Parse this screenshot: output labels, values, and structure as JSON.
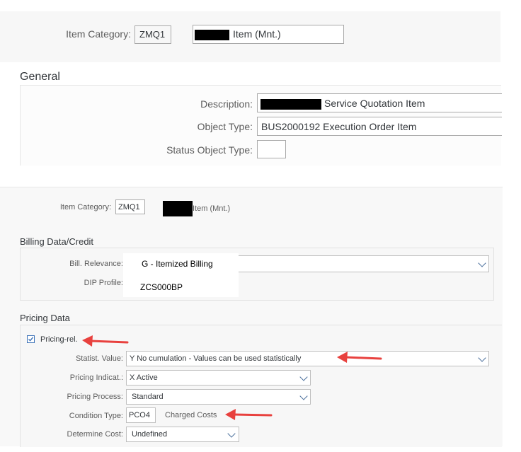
{
  "top": {
    "item_category_label": "Item Category:",
    "item_category_value": "ZMQ1",
    "item_category_desc": "Item (Mnt.)",
    "general_title": "General",
    "description_label": "Description:",
    "description_value": "Service Quotation Item",
    "object_type_label": "Object Type:",
    "object_type_value": "BUS2000192 Execution Order Item",
    "status_object_type_label": "Status Object Type:",
    "status_object_type_value": ""
  },
  "bottom": {
    "item_category_label": "Item Category:",
    "item_category_value": "ZMQ1",
    "item_category_desc": "Item (Mnt.)",
    "billing_title": "Billing Data/Credit",
    "bill_relevance_label": "Bill. Relevance:",
    "bill_relevance_value": "G - Itemized Billing",
    "dip_profile_label": "DIP Profile:",
    "dip_profile_value": "ZCS000BP",
    "pricing_title": "Pricing Data",
    "pricing_rel_label": "Pricing-rel.",
    "pricing_rel_checked": true,
    "statist_value_label": "Statist. Value:",
    "statist_value_value": "Y No cumulation - Values can be used statistically",
    "pricing_indicat_label": "Pricing Indicat.:",
    "pricing_indicat_value": "X Active",
    "pricing_process_label": "Pricing Process:",
    "pricing_process_value": "Standard",
    "condition_type_label": "Condition Type:",
    "condition_type_value": "PCO4",
    "condition_type_desc": "Charged Costs",
    "determine_cost_label": "Determine Cost:",
    "determine_cost_value": "Undefined"
  },
  "colors": {
    "arrow": "#e8413e",
    "chevron": "#4a6f9c",
    "checkbox": "#3c72b8"
  }
}
